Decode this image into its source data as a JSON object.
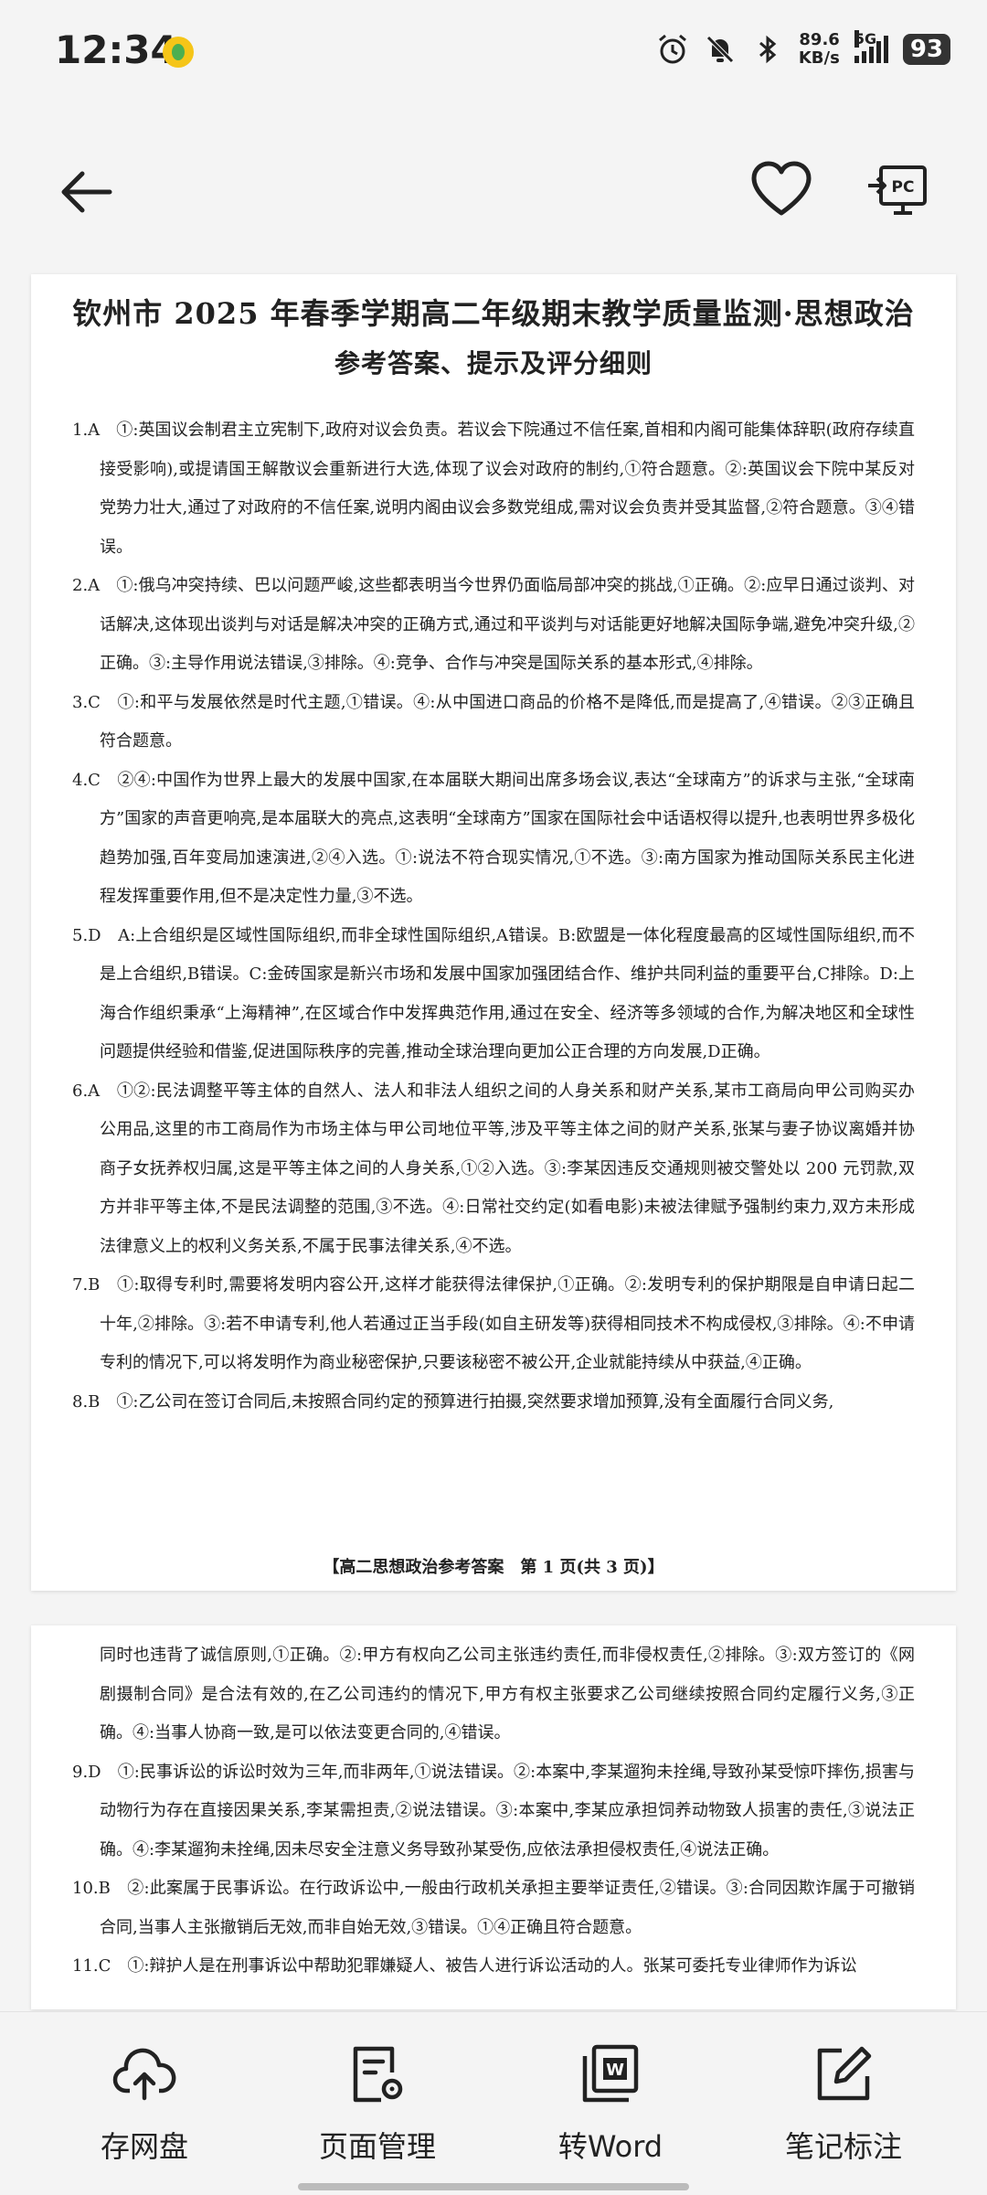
{
  "status": {
    "time": "12:34",
    "net_speed": "89.6",
    "net_unit": "KB/s",
    "network": "5G",
    "battery": "93"
  },
  "document": {
    "title": "钦州市 2025 年春季学期高二年级期末教学质量监测·思想政治",
    "subtitle": "参考答案、提示及评分细则",
    "page1_items": [
      "1.A　①:英国议会制君主立宪制下,政府对议会负责。若议会下院通过不信任案,首相和内阁可能集体辞职(政府存续直接受影响),或提请国王解散议会重新进行大选,体现了议会对政府的制约,①符合题意。②:英国议会下院中某反对党势力壮大,通过了对政府的不信任案,说明内阁由议会多数党组成,需对议会负责并受其监督,②符合题意。③④错误。",
      "2.A　①:俄乌冲突持续、巴以问题严峻,这些都表明当今世界仍面临局部冲突的挑战,①正确。②:应早日通过谈判、对话解决,这体现出谈判与对话是解决冲突的正确方式,通过和平谈判与对话能更好地解决国际争端,避免冲突升级,②正确。③:主导作用说法错误,③排除。④:竞争、合作与冲突是国际关系的基本形式,④排除。",
      "3.C　①:和平与发展依然是时代主题,①错误。④:从中国进口商品的价格不是降低,而是提高了,④错误。②③正确且符合题意。",
      "4.C　②④:中国作为世界上最大的发展中国家,在本届联大期间出席多场会议,表达“全球南方”的诉求与主张,“全球南方”国家的声音更响亮,是本届联大的亮点,这表明“全球南方”国家在国际社会中话语权得以提升,也表明世界多极化趋势加强,百年变局加速演进,②④入选。①:说法不符合现实情况,①不选。③:南方国家为推动国际关系民主化进程发挥重要作用,但不是决定性力量,③不选。",
      "5.D　A:上合组织是区域性国际组织,而非全球性国际组织,A错误。B:欧盟是一体化程度最高的区域性国际组织,而不是上合组织,B错误。C:金砖国家是新兴市场和发展中国家加强团结合作、维护共同利益的重要平台,C排除。D:上海合作组织秉承“上海精神”,在区域合作中发挥典范作用,通过在安全、经济等多领域的合作,为解决地区和全球性问题提供经验和借鉴,促进国际秩序的完善,推动全球治理向更加公正合理的方向发展,D正确。",
      "6.A　①②:民法调整平等主体的自然人、法人和非法人组织之间的人身关系和财产关系,某市工商局向甲公司购买办公用品,这里的市工商局作为市场主体与甲公司地位平等,涉及平等主体之间的财产关系,张某与妻子协议离婚并协商子女抚养权归属,这是平等主体之间的人身关系,①②入选。③:李某因违反交通规则被交警处以 200 元罚款,双方并非平等主体,不是民法调整的范围,③不选。④:日常社交约定(如看电影)未被法律赋予强制约束力,双方未形成法律意义上的权利义务关系,不属于民事法律关系,④不选。",
      "7.B　①:取得专利时,需要将发明内容公开,这样才能获得法律保护,①正确。②:发明专利的保护期限是自申请日起二十年,②排除。③:若不申请专利,他人若通过正当手段(如自主研发等)获得相同技术不构成侵权,③排除。④:不申请专利的情况下,可以将发明作为商业秘密保护,只要该秘密不被公开,企业就能持续从中获益,④正确。",
      "8.B　①:乙公司在签订合同后,未按照合同约定的预算进行拍摄,突然要求增加预算,没有全面履行合同义务,"
    ],
    "page1_footer": "【高二思想政治参考答案　第 1 页(共 3 页)】",
    "page2_cont": "同时也违背了诚信原则,①正确。②:甲方有权向乙公司主张违约责任,而非侵权责任,②排除。③:双方签订的《网剧摄制合同》是合法有效的,在乙公司违约的情况下,甲方有权主张要求乙公司继续按照合同约定履行义务,③正确。④:当事人协商一致,是可以依法变更合同的,④错误。",
    "page2_items": [
      "9.D　①:民事诉讼的诉讼时效为三年,而非两年,①说法错误。②:本案中,李某遛狗未拴绳,导致孙某受惊吓摔伤,损害与动物行为存在直接因果关系,李某需担责,②说法错误。③:本案中,李某应承担饲养动物致人损害的责任,③说法正确。④:李某遛狗未拴绳,因未尽安全注意义务导致孙某受伤,应依法承担侵权责任,④说法正确。",
      "10.B　②:此案属于民事诉讼。在行政诉讼中,一般由行政机关承担主要举证责任,②错误。③:合同因欺诈属于可撤销合同,当事人主张撤销后无效,而非自始无效,③错误。①④正确且符合题意。",
      "11.C　①:辩护人是在刑事诉讼中帮助犯罪嫌疑人、被告人进行诉讼活动的人。张某可委托专业律师作为诉讼"
    ]
  },
  "bottom_tools": [
    {
      "label": "存网盘"
    },
    {
      "label": "页面管理"
    },
    {
      "label": "转Word"
    },
    {
      "label": "笔记标注"
    }
  ]
}
